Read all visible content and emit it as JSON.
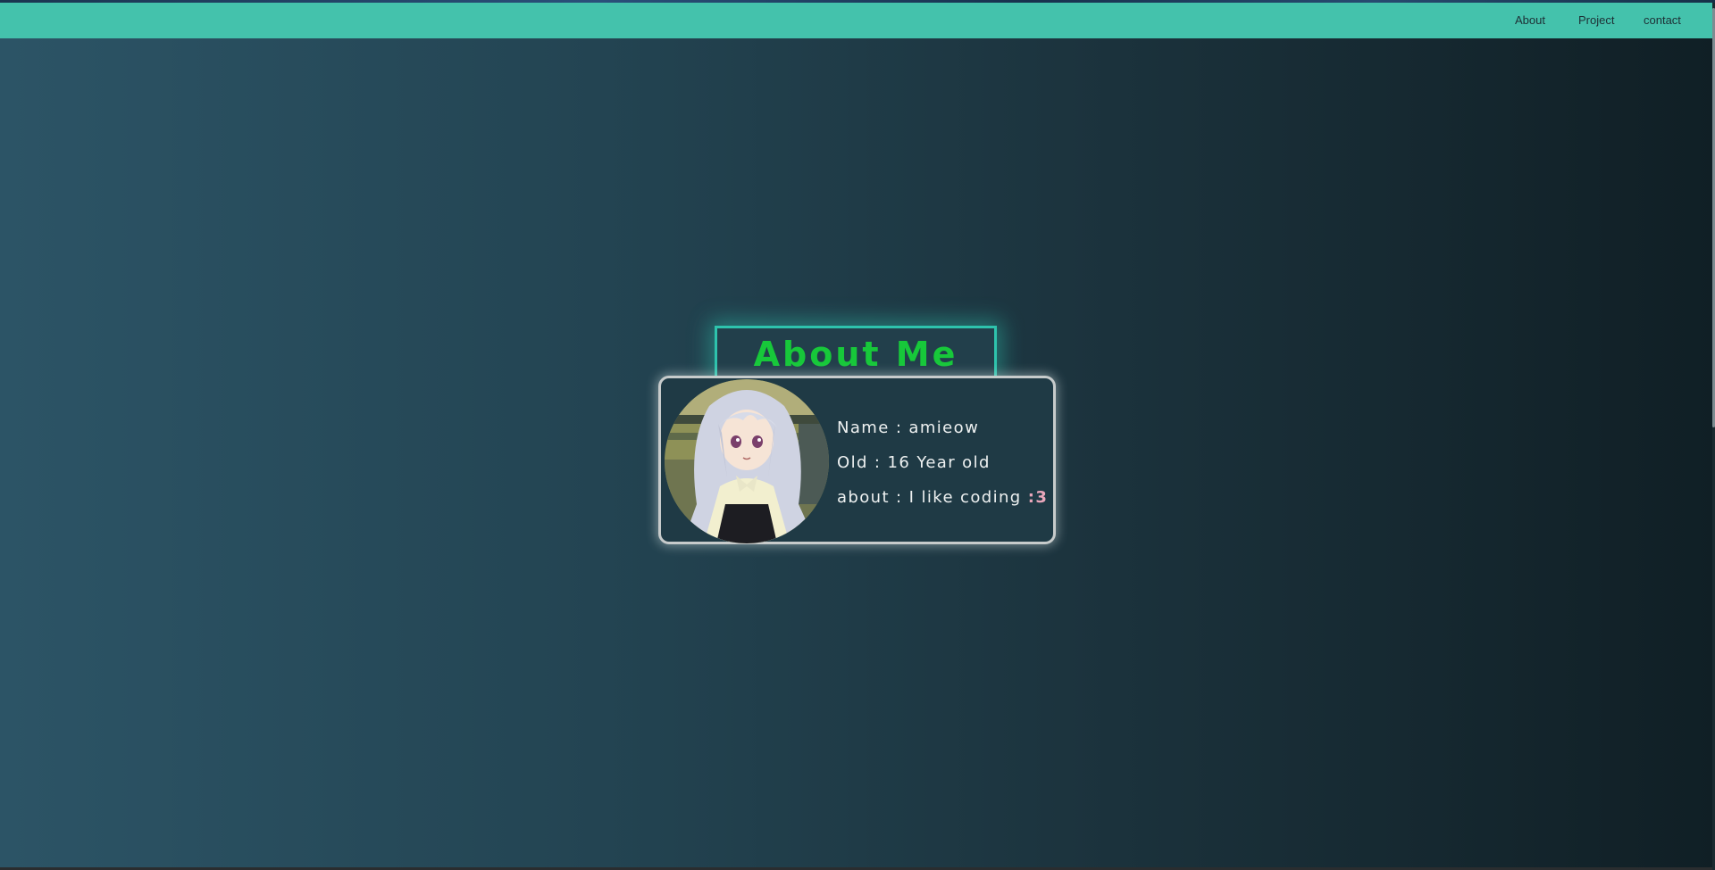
{
  "nav": {
    "items": [
      {
        "label": "About"
      },
      {
        "label": "Project"
      },
      {
        "label": "contact"
      }
    ]
  },
  "main": {
    "title": "About Me",
    "profile": {
      "name_line": "Name : amieow",
      "old_line": "Old : 16 Year old",
      "about_line": "about : I like coding ",
      "about_emote": ":3",
      "avatar_icon": "anime-girl-avatar"
    }
  },
  "colors": {
    "navbar": "#44c2ac",
    "title_text": "#17c83a",
    "title_border": "#2ec3ad",
    "card_border": "#c7cbcb",
    "emote": "#e9a7bb"
  }
}
